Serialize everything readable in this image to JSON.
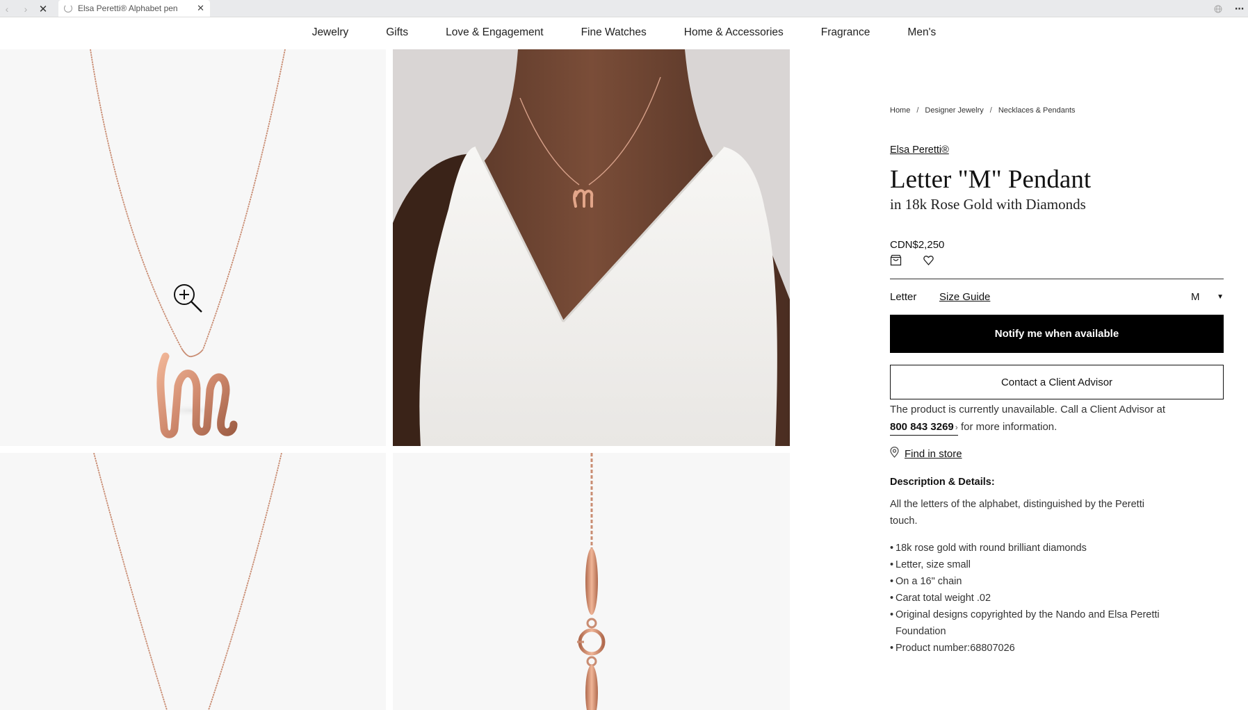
{
  "browser": {
    "tab_title": "Elsa Peretti® Alphabet pen",
    "tab_close": "✕",
    "back": "‹",
    "forward": "›",
    "stop": "✕",
    "menu": "⋯"
  },
  "nav": {
    "items": [
      "Jewelry",
      "Gifts",
      "Love & Engagement",
      "Fine Watches",
      "Home & Accessories",
      "Fragrance",
      "Men's"
    ]
  },
  "breadcrumb": {
    "items": [
      "Home",
      "Designer Jewelry",
      "Necklaces & Pendants"
    ],
    "separator": "/"
  },
  "product": {
    "brand": "Elsa Peretti®",
    "title": "Letter \"M\" Pendant",
    "subtitle": "in 18k Rose Gold with Diamonds",
    "price": "CDN$2,250",
    "letter_label": "Letter",
    "size_guide": "Size Guide",
    "letter_value": "M",
    "caret": "▼",
    "notify_button": "Notify me when available",
    "contact_button": "Contact a Client Advisor",
    "unavailable_text": "The product is currently unavailable. Call a Client Advisor at",
    "phone": "800 843 3269",
    "phone_chevron": "›",
    "unavailable_suffix": "for more information.",
    "find_in_store": "Find in store",
    "description_title": "Description & Details:",
    "description": "All the letters of the alphabet, distinguished by the Peretti touch.",
    "details": [
      "18k rose gold with round brilliant diamonds",
      "Letter, size small",
      "On a 16\" chain",
      "Carat total weight .02",
      "Original designs copyrighted by the Nando and Elsa Peretti Foundation",
      "Product number:68807026"
    ]
  },
  "colors": {
    "rose_gold": "#d08a6e",
    "button_black": "#000000",
    "skin": "#6b4331",
    "dress": "#f1f0ee"
  },
  "icons": {
    "zoom": "zoom-in-icon",
    "bag": "shopping-bag-icon",
    "wishlist": "heart-icon",
    "location": "location-pin-icon"
  }
}
